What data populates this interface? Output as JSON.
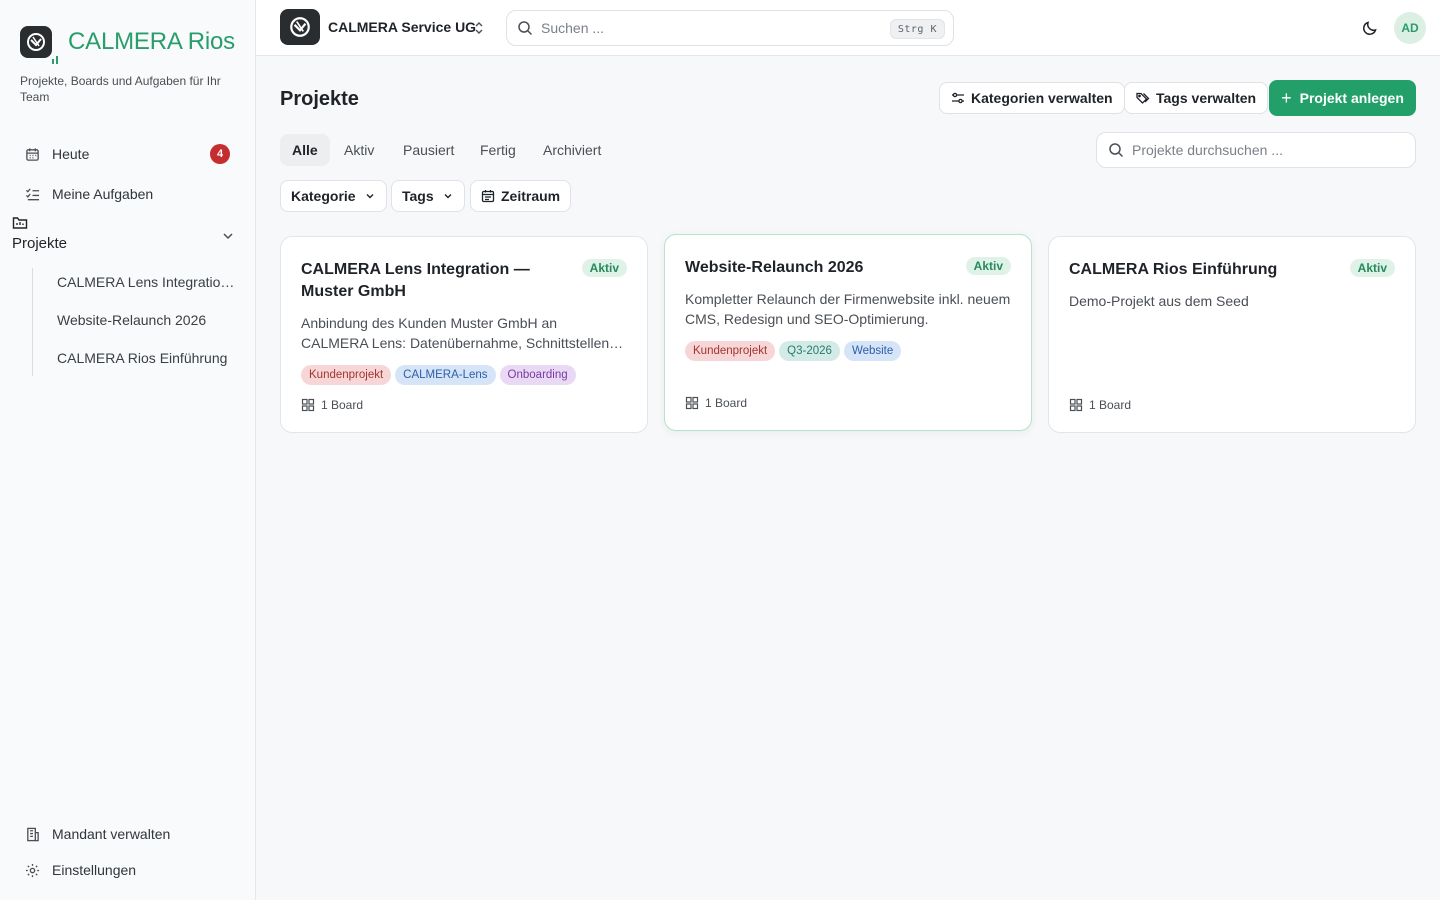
{
  "brand": {
    "name": "CALMERA Rios",
    "subtitle": "Projekte, Boards und Aufgaben für Ihr Team"
  },
  "sidebar": {
    "items": [
      {
        "label": "Heute",
        "icon": "calendar-icon",
        "badge": "4"
      },
      {
        "label": "Meine Aufgaben",
        "icon": "task-list-icon"
      }
    ],
    "projects_label": "Projekte",
    "projects": [
      {
        "label": "CALMERA Lens Integration — Muster GmbH"
      },
      {
        "label": "Website-Relaunch 2026"
      },
      {
        "label": "CALMERA Rios Einführung"
      }
    ],
    "footer_items": [
      {
        "label": "Mandant verwalten",
        "icon": "building-icon"
      },
      {
        "label": "Einstellungen",
        "icon": "gear-icon"
      }
    ]
  },
  "topbar": {
    "tenant": "CALMERA Service UG",
    "search_placeholder": "Suchen ...",
    "search_shortcut": "Strg K",
    "avatar": "AD"
  },
  "main": {
    "title": "Projekte",
    "actions": {
      "categories": "Kategorien verwalten",
      "tags": "Tags verwalten",
      "create": "Projekt anlegen"
    },
    "tabs": [
      {
        "label": "Alle",
        "active": true
      },
      {
        "label": "Aktiv"
      },
      {
        "label": "Pausiert"
      },
      {
        "label": "Fertig"
      },
      {
        "label": "Archiviert"
      }
    ],
    "search_placeholder": "Projekte durchsuchen ...",
    "filters": {
      "category": "Kategorie",
      "tags": "Tags",
      "period": "Zeitraum"
    },
    "projects": [
      {
        "title": "CALMERA Lens Integration — Muster GmbH",
        "status": "Aktiv",
        "description": "Anbindung des Kunden Muster GmbH an CALMERA Lens: Datenübernahme, Schnittstellen-Tests und Go-Live-Begleitung.",
        "tags": [
          {
            "label": "Kundenprojekt",
            "color": "#f6d6d6"
          },
          {
            "label": "CALMERA-Lens",
            "color": "#d6e4f8"
          },
          {
            "label": "Onboarding",
            "color": "#ead9f4"
          }
        ],
        "boards": "1 Board"
      },
      {
        "title": "Website-Relaunch 2026",
        "status": "Aktiv",
        "description": "Kompletter Relaunch der Firmenwebsite inkl. neuem CMS, Redesign und SEO-Optimierung.",
        "tags": [
          {
            "label": "Kundenprojekt",
            "color": "#f6d6d6"
          },
          {
            "label": "Q3-2026",
            "color": "#d3ebe7"
          },
          {
            "label": "Website",
            "color": "#d6e4f8"
          }
        ],
        "boards": "1 Board"
      },
      {
        "title": "CALMERA Rios Einführung",
        "status": "Aktiv",
        "description": "Demo-Projekt aus dem Seed",
        "tags": [],
        "boards": "1 Board"
      }
    ]
  },
  "colors": {
    "accent": "#23a06a",
    "brand_text": "#2a9d6c",
    "badge": "#c52e2e"
  }
}
